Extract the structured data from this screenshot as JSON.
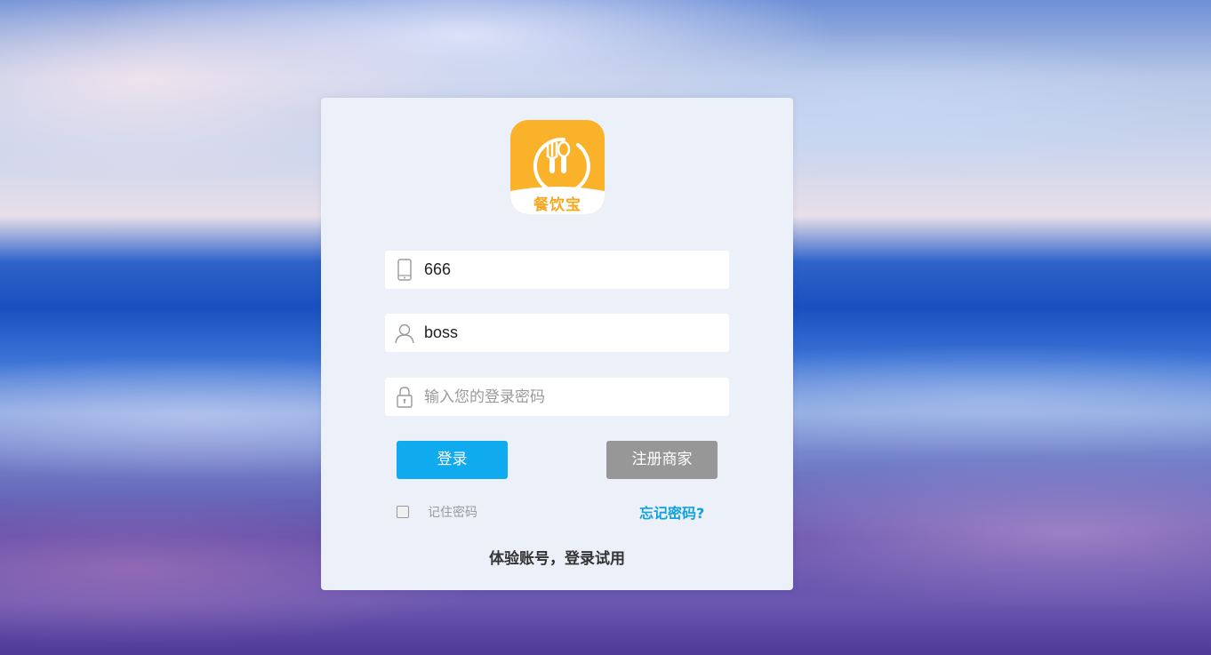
{
  "logo": {
    "text": "餐饮宝",
    "icon": "fork-spoon-icon",
    "color": "#fbb22b"
  },
  "form": {
    "phone": {
      "value": "666",
      "icon": "mobile-phone-icon"
    },
    "username": {
      "value": "boss",
      "icon": "user-icon"
    },
    "password": {
      "value": "",
      "placeholder": "输入您的登录密码",
      "icon": "lock-icon"
    }
  },
  "buttons": {
    "login_label": "登录",
    "register_label": "注册商家",
    "login_color": "#10aaef",
    "register_color": "#979797"
  },
  "remember": {
    "label": "记住密码",
    "checked": false
  },
  "forgot_label": "忘记密码?",
  "trial_label": "体验账号，登录试用"
}
